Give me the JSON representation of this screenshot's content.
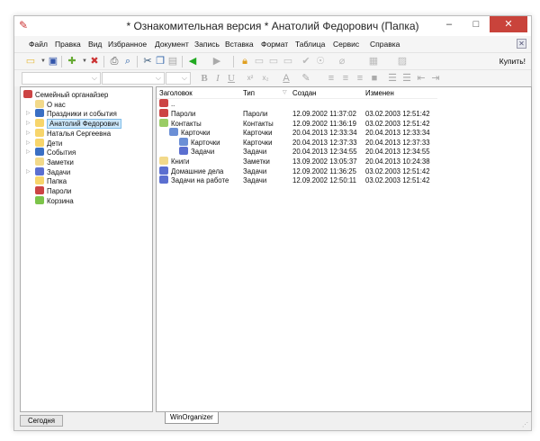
{
  "window": {
    "title": "* Ознакомительная версия * Анатолий Федорович (Папка)",
    "minimize": "–",
    "maximize": "□",
    "close": "✕"
  },
  "menu": [
    "Файл",
    "Правка",
    "Вид",
    "Избранное",
    "Документ",
    "Запись",
    "Вставка",
    "Формат",
    "Таблица",
    "Сервис",
    "Справка"
  ],
  "toolbar": {
    "buy": "Купить!",
    "format": {
      "bold": "B",
      "italic": "I",
      "underline": "U",
      "sup": "x²",
      "sub": "x₂",
      "font_color": "A"
    }
  },
  "tree": [
    {
      "label": "Семейный органайзер",
      "level": 0,
      "color": "#c44"
    },
    {
      "label": "О нас",
      "level": 1,
      "color": "#f2d98a"
    },
    {
      "label": "Праздники и события",
      "level": 1,
      "color": "#3a6fc4",
      "expand": true
    },
    {
      "label": "Анатолий Федорович",
      "level": 1,
      "color": "#f7d56b",
      "expand": true,
      "selected": true
    },
    {
      "label": "Наталья Сергеевна",
      "level": 1,
      "color": "#f7d56b",
      "expand": true
    },
    {
      "label": "Дети",
      "level": 1,
      "color": "#f7d56b",
      "expand": true
    },
    {
      "label": "События",
      "level": 1,
      "color": "#3a6fc4",
      "expand": true
    },
    {
      "label": "Заметки",
      "level": 1,
      "color": "#f2d98a"
    },
    {
      "label": "Задачи",
      "level": 1,
      "color": "#5b6fd0",
      "expand": true
    },
    {
      "label": "Папка",
      "level": 1,
      "color": "#f7d56b"
    },
    {
      "label": "Пароли",
      "level": 1,
      "color": "#c44"
    },
    {
      "label": "Корзина",
      "level": 1,
      "color": "#7cc44a"
    }
  ],
  "list": {
    "columns": [
      "Заголовок",
      "Тип",
      "Создан",
      "Изменен"
    ],
    "up": "..",
    "rows": [
      {
        "title": "Пароли",
        "type": "Пароли",
        "created": "12.09.2002 11:37:02",
        "modified": "03.02.2003 12:51:42",
        "level": 0,
        "color": "#c44"
      },
      {
        "title": "Контакты",
        "type": "Контакты",
        "created": "12.09.2002 11:36:19",
        "modified": "03.02.2003 12:51:42",
        "level": 0,
        "color": "#9c6"
      },
      {
        "title": "Карточки",
        "type": "Карточки",
        "created": "20.04.2013 12:33:34",
        "modified": "20.04.2013 12:33:34",
        "level": 1,
        "color": "#6b8fd6"
      },
      {
        "title": "Карточки",
        "type": "Карточки",
        "created": "20.04.2013 12:37:33",
        "modified": "20.04.2013 12:37:33",
        "level": 2,
        "color": "#6b8fd6"
      },
      {
        "title": "Задачи",
        "type": "Задачи",
        "created": "20.04.2013 12:34:55",
        "modified": "20.04.2013 12:34:55",
        "level": 2,
        "color": "#5b6fd0"
      },
      {
        "title": "Книги",
        "type": "Заметки",
        "created": "13.09.2002 13:05:37",
        "modified": "20.04.2013 10:24:38",
        "level": 0,
        "color": "#f2d98a"
      },
      {
        "title": "Домашние дела",
        "type": "Задачи",
        "created": "12.09.2002 11:36:25",
        "modified": "03.02.2003 12:51:42",
        "level": 0,
        "color": "#5b6fd0"
      },
      {
        "title": "Задачи на работе",
        "type": "Задачи",
        "created": "12.09.2002 12:50:11",
        "modified": "03.02.2003 12:51:42",
        "level": 0,
        "color": "#5b6fd0"
      }
    ]
  },
  "status": {
    "today": "Сегодня",
    "tab": "WinOrganizer"
  }
}
